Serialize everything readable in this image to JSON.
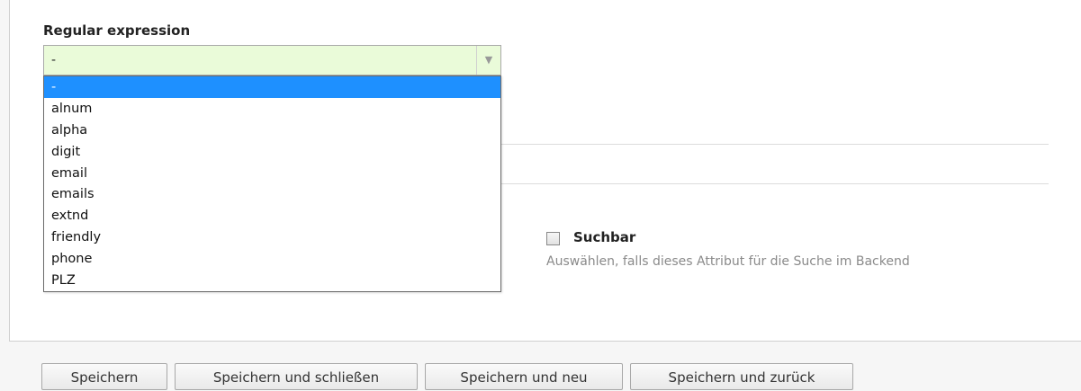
{
  "field": {
    "label": "Regular expression",
    "selected_value": "-"
  },
  "dropdown": {
    "options": [
      "-",
      "alnum",
      "alpha",
      "digit",
      "email",
      "emails",
      "extnd",
      "friendly",
      "phone",
      "PLZ"
    ],
    "highlighted_index": 0
  },
  "searchable": {
    "label": "Suchbar",
    "help": "Auswählen, falls dieses Attribut für die Suche im Backend",
    "checked": false
  },
  "buttons": {
    "save": "Speichern",
    "save_close": "Speichern und schließen",
    "save_new": "Speichern und neu",
    "save_back": "Speichern und zurück"
  },
  "colors": {
    "select_background": "#eafbd9",
    "highlight": "#1e90ff"
  }
}
